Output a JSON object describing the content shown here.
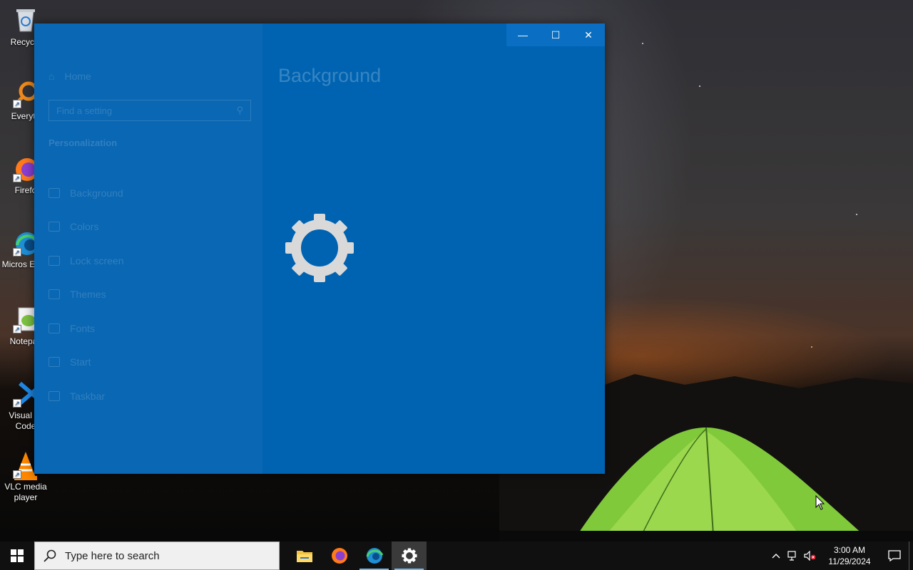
{
  "desktop": {
    "icons": [
      {
        "label": "Recycle",
        "icon": "recycle-bin-icon"
      },
      {
        "label": "Everyth",
        "icon": "everything-search-icon"
      },
      {
        "label": "Firefo",
        "icon": "firefox-icon"
      },
      {
        "label": "Micros Edge",
        "icon": "edge-icon"
      },
      {
        "label": "Notepac",
        "icon": "notepad-plus-plus-icon"
      },
      {
        "label": "Visual St Code",
        "icon": "vscode-icon"
      },
      {
        "label": "VLC media player",
        "icon": "vlc-icon"
      }
    ]
  },
  "window": {
    "controls": {
      "minimize": "—",
      "maximize": "☐",
      "close": "✕"
    },
    "sidebar": {
      "home_label": "Home",
      "search_placeholder": "Find a setting",
      "section_title": "Personalization",
      "items": [
        {
          "label": "Background",
          "icon": "picture-icon"
        },
        {
          "label": "Colors",
          "icon": "palette-icon"
        },
        {
          "label": "Lock screen",
          "icon": "lock-screen-icon"
        },
        {
          "label": "Themes",
          "icon": "themes-icon"
        },
        {
          "label": "Fonts",
          "icon": "fonts-icon"
        },
        {
          "label": "Start",
          "icon": "start-icon"
        },
        {
          "label": "Taskbar",
          "icon": "taskbar-icon"
        }
      ]
    },
    "page_title": "Background",
    "splash_icon": "settings-gear-icon"
  },
  "taskbar": {
    "search_placeholder": "Type here to search",
    "apps": [
      {
        "name": "File Explorer",
        "icon": "folder-icon",
        "running": false
      },
      {
        "name": "Firefox",
        "icon": "firefox-icon",
        "running": false
      },
      {
        "name": "Microsoft Edge",
        "icon": "edge-icon",
        "running": true
      },
      {
        "name": "Settings",
        "icon": "settings-gear-icon",
        "running": true,
        "active": true
      }
    ],
    "clock": {
      "time": "3:00 AM",
      "date": "11/29/2024"
    }
  },
  "colors": {
    "settings_blue": "#0063b1",
    "taskbar": "#101010"
  }
}
